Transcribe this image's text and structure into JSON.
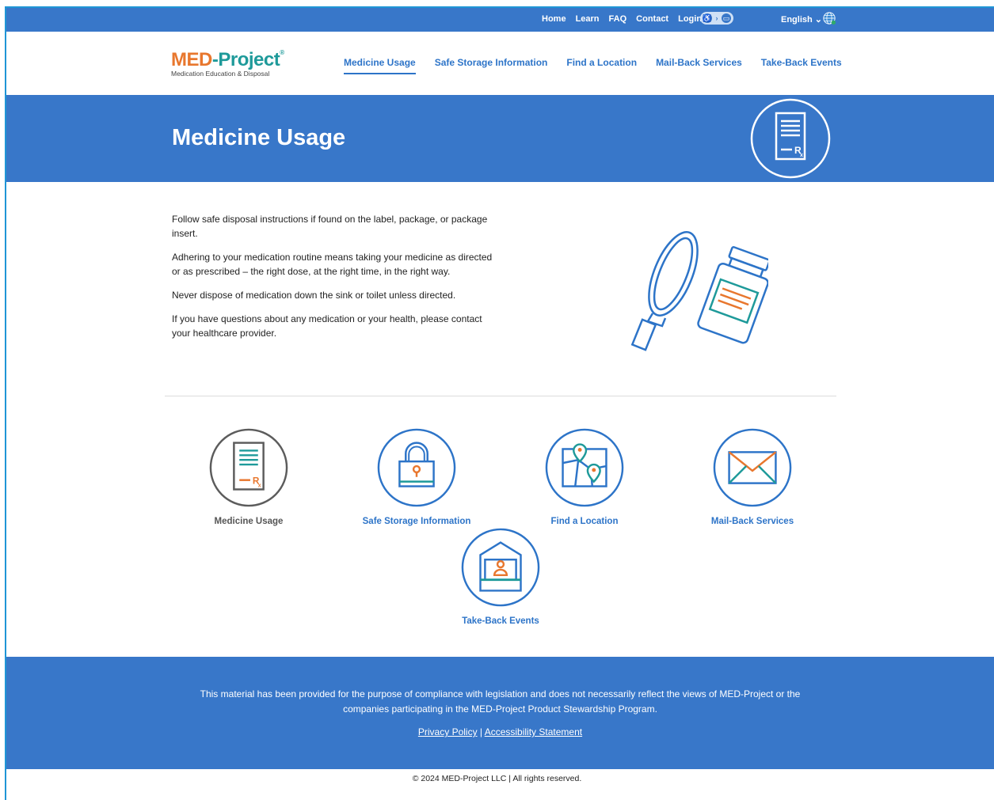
{
  "utility": {
    "links": [
      "Home",
      "Learn",
      "FAQ",
      "Contact",
      "Login"
    ],
    "language": "English",
    "lang_chevron": "⌄"
  },
  "logo": {
    "med": "MED",
    "dash": "-",
    "project": "Project",
    "reg": "®",
    "tagline": "Medication Education & Disposal"
  },
  "nav": {
    "items": [
      "Medicine Usage",
      "Safe Storage Information",
      "Find a Location",
      "Mail-Back Services",
      "Take-Back Events"
    ],
    "active": "Medicine Usage"
  },
  "hero": {
    "title": "Medicine Usage",
    "icon": "prescription-document-icon"
  },
  "content": {
    "paragraphs": [
      "Follow safe disposal instructions if found on the label, package, or package insert.",
      "Adhering to your medication routine means taking your medicine as directed or as prescribed – the right dose, at the right time, in the right way.",
      "Never dispose of medication down the sink or toilet unless directed.",
      "If you have questions about any medication or your health, please contact your healthcare provider."
    ],
    "illustration": "magnifier-pill-bottle-icon"
  },
  "cards": [
    {
      "label": "Medicine Usage",
      "icon": "prescription-document-icon"
    },
    {
      "label": "Safe Storage Information",
      "icon": "padlock-icon"
    },
    {
      "label": "Find a Location",
      "icon": "map-pin-icon"
    },
    {
      "label": "Mail-Back Services",
      "icon": "envelope-icon"
    },
    {
      "label": "Take-Back Events",
      "icon": "kiosk-person-icon"
    }
  ],
  "footer": {
    "disclaimer_line1": "This material has been provided for the purpose of compliance with legislation and does not necessarily reflect the views of MED-Project or the",
    "disclaimer_line2": "companies participating in the MED-Project Product Stewardship Program.",
    "privacy": "Privacy Policy",
    "separator": " | ",
    "accessibility": "Accessibility Statement",
    "copyright": "© 2024 MED-Project LLC | All rights reserved."
  },
  "colors": {
    "brand_blue": "#3877c9",
    "nav_blue": "#2d74c8",
    "orange": "#e8772e",
    "teal": "#1e9a9a",
    "grey_icon": "#5c5c5c"
  }
}
